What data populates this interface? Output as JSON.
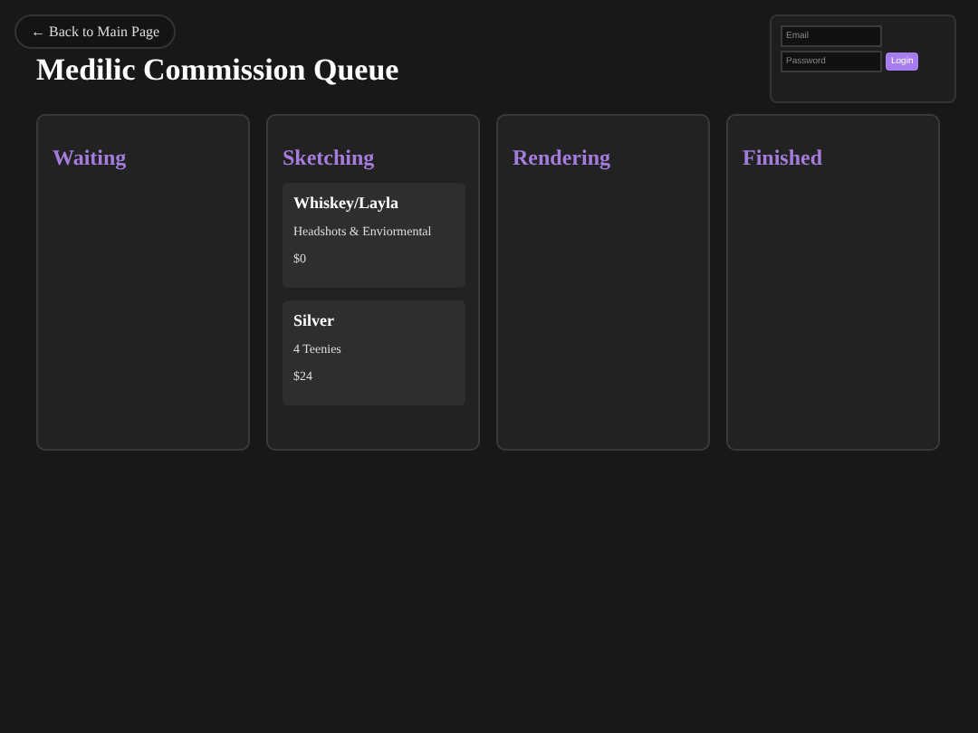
{
  "back_link": {
    "label": "← Back to Main Page"
  },
  "title": "Medilic Commission Queue",
  "login": {
    "email_placeholder": "Email",
    "password_placeholder": "Password",
    "button": "Login"
  },
  "columns": [
    {
      "title": "Waiting"
    },
    {
      "title": "Sketching",
      "cards": [
        {
          "name": "Whiskey/Layla",
          "description": "Headshots & Enviormental",
          "price": "$0"
        },
        {
          "name": "Silver",
          "description": "4 Teenies",
          "price": "$24"
        }
      ]
    },
    {
      "title": "Rendering"
    },
    {
      "title": "Finished"
    }
  ]
}
